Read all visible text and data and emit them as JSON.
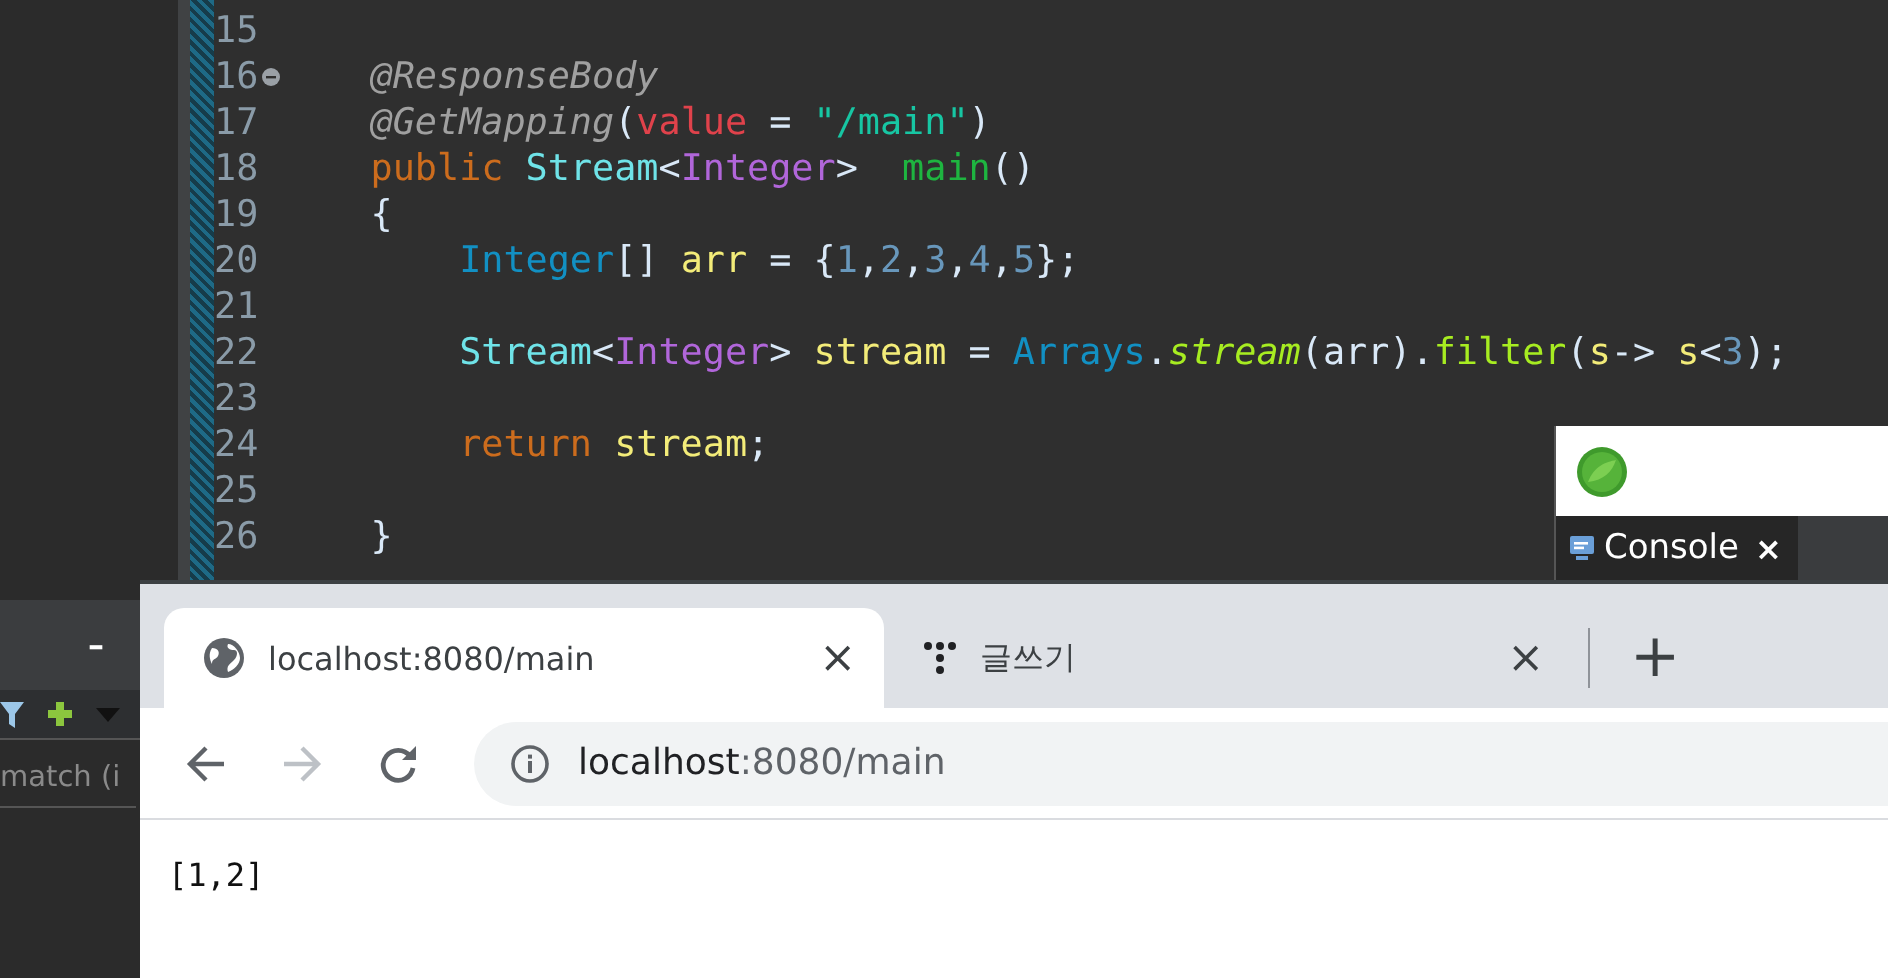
{
  "editor": {
    "lines": [
      {
        "number": "15"
      },
      {
        "number": "16",
        "tokens": [
          {
            "text": "    @ResponseBody",
            "kind": "annotation"
          }
        ]
      },
      {
        "number": "17",
        "tokens": [
          {
            "text": "    @GetMapping",
            "kind": "annotation"
          },
          {
            "text": "(",
            "kind": "plain"
          },
          {
            "text": "value",
            "kind": "param"
          },
          {
            "text": " = ",
            "kind": "plain"
          },
          {
            "text": "\"/main\"",
            "kind": "string"
          },
          {
            "text": ")",
            "kind": "plain"
          }
        ]
      },
      {
        "number": "18",
        "tokens": [
          {
            "text": "    public ",
            "kind": "keyword"
          },
          {
            "text": "Stream",
            "kind": "type"
          },
          {
            "text": "<",
            "kind": "plain"
          },
          {
            "text": "Integer",
            "kind": "generic"
          },
          {
            "text": ">  ",
            "kind": "plain"
          },
          {
            "text": "main",
            "kind": "method"
          },
          {
            "text": "()",
            "kind": "plain"
          }
        ]
      },
      {
        "number": "19",
        "tokens": [
          {
            "text": "    {",
            "kind": "plain"
          }
        ]
      },
      {
        "number": "20",
        "tokens": [
          {
            "text": "        Integer",
            "kind": "class"
          },
          {
            "text": "[] ",
            "kind": "plain"
          },
          {
            "text": "arr",
            "kind": "variable"
          },
          {
            "text": " = {",
            "kind": "plain"
          },
          {
            "text": "1",
            "kind": "number"
          },
          {
            "text": ",",
            "kind": "plain"
          },
          {
            "text": "2",
            "kind": "number"
          },
          {
            "text": ",",
            "kind": "plain"
          },
          {
            "text": "3",
            "kind": "number"
          },
          {
            "text": ",",
            "kind": "plain"
          },
          {
            "text": "4",
            "kind": "number"
          },
          {
            "text": ",",
            "kind": "plain"
          },
          {
            "text": "5",
            "kind": "number"
          },
          {
            "text": "};",
            "kind": "plain"
          }
        ]
      },
      {
        "number": "21"
      },
      {
        "number": "22",
        "tokens": [
          {
            "text": "        Stream",
            "kind": "type"
          },
          {
            "text": "<",
            "kind": "plain"
          },
          {
            "text": "Integer",
            "kind": "generic"
          },
          {
            "text": "> ",
            "kind": "plain"
          },
          {
            "text": "stream",
            "kind": "variable"
          },
          {
            "text": " = ",
            "kind": "plain"
          },
          {
            "text": "Arrays",
            "kind": "class"
          },
          {
            "text": ".",
            "kind": "plain"
          },
          {
            "text": "stream",
            "kind": "static"
          },
          {
            "text": "(arr).",
            "kind": "plain"
          },
          {
            "text": "filter",
            "kind": "call"
          },
          {
            "text": "(",
            "kind": "plain"
          },
          {
            "text": "s",
            "kind": "variable"
          },
          {
            "text": "-> ",
            "kind": "plain"
          },
          {
            "text": "s",
            "kind": "variable"
          },
          {
            "text": "<",
            "kind": "plain"
          },
          {
            "text": "3",
            "kind": "number"
          },
          {
            "text": ");",
            "kind": "plain"
          }
        ]
      },
      {
        "number": "23"
      },
      {
        "number": "24",
        "tokens": [
          {
            "text": "        return ",
            "kind": "keyword"
          },
          {
            "text": "stream",
            "kind": "variable"
          },
          {
            "text": ";",
            "kind": "plain"
          }
        ]
      },
      {
        "number": "25"
      },
      {
        "number": "26",
        "tokens": [
          {
            "text": "    }",
            "kind": "plain"
          }
        ]
      }
    ]
  },
  "side_panel": {
    "minimize": "–",
    "filter": {
      "placeholder": "match (i"
    }
  },
  "console_panel": {
    "tab": {
      "label": "Console",
      "close": "×"
    }
  },
  "browser": {
    "tabs": [
      {
        "title": "localhost:8080/main",
        "close": "×",
        "selected": true
      },
      {
        "title": "글쓰기",
        "close": "×",
        "selected": false
      }
    ],
    "new_tab": "+",
    "address": {
      "host": "localhost",
      "path": ":8080/main"
    },
    "page_text": "[1,2]"
  }
}
